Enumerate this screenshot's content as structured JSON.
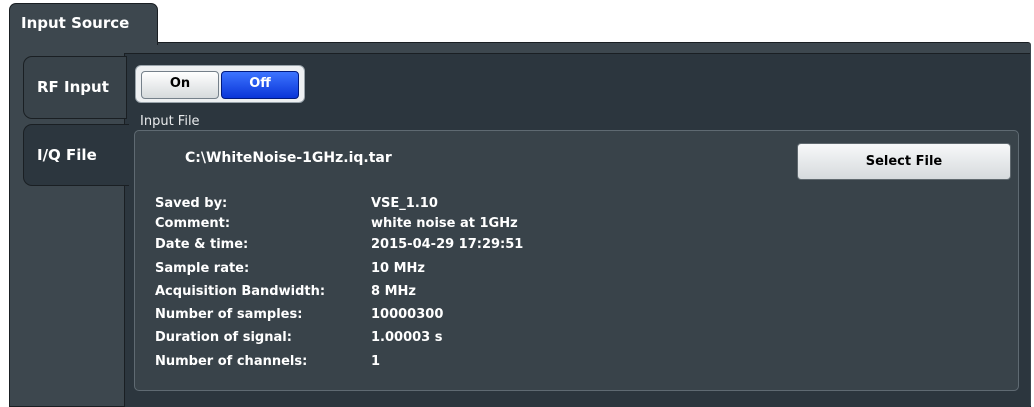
{
  "header": {
    "tab_label": "Input Source"
  },
  "side_tabs": [
    {
      "label": "RF Input"
    },
    {
      "label": "I/Q File"
    }
  ],
  "rf_toggle": {
    "on_label": "On",
    "off_label": "Off",
    "selected": "Off"
  },
  "input_file": {
    "group_label": "Input File",
    "path": "C:\\WhiteNoise-1GHz.iq.tar",
    "select_button_label": "Select File",
    "info": [
      {
        "label": "Saved by:",
        "value": "VSE_1.10"
      },
      {
        "label": "Comment:",
        "value": "white noise at 1GHz"
      },
      {
        "label": "Date & time:",
        "value": "2015-04-29 17:29:51"
      },
      {
        "label": "Sample rate:",
        "value": "10 MHz"
      },
      {
        "label": "Acquisition Bandwidth:",
        "value": "8 MHz"
      },
      {
        "label": "Number of samples:",
        "value": "10000300"
      },
      {
        "label": "Duration of signal:",
        "value": "1.00003 s"
      },
      {
        "label": "Number of channels:",
        "value": "1"
      }
    ]
  },
  "colors": {
    "panel_bg": "#3d474e",
    "content_bg": "#2c363e",
    "toggle_selected": "#0a35d8"
  }
}
